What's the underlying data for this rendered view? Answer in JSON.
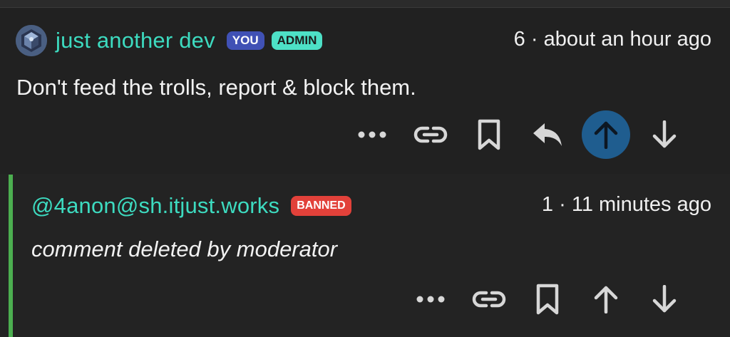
{
  "comments": [
    {
      "username": "just another dev",
      "badges": [
        "YOU",
        "ADMIN"
      ],
      "score": "6",
      "separator": "·",
      "time": "about an hour ago",
      "body": "Don't feed the trolls, report & block them.",
      "actions": [
        "more-icon",
        "link-icon",
        "bookmark-icon",
        "reply-icon",
        "upvote-icon",
        "downvote-icon"
      ],
      "upvote_active": true
    },
    {
      "username": "@4anon@sh.itjust.works",
      "badges": [
        "BANNED"
      ],
      "score": "1",
      "separator": "·",
      "time": "11 minutes ago",
      "body": "comment deleted by moderator",
      "actions": [
        "more-icon",
        "link-icon",
        "bookmark-icon",
        "upvote-icon",
        "downvote-icon"
      ],
      "upvote_active": false
    }
  ],
  "colors": {
    "username": "#3ddbc0",
    "badge_you": "#4051b5",
    "badge_admin": "#4de0c6",
    "badge_banned": "#e2413a",
    "upvote_active": "#1f5d8f",
    "reply_border": "#4caf50"
  }
}
